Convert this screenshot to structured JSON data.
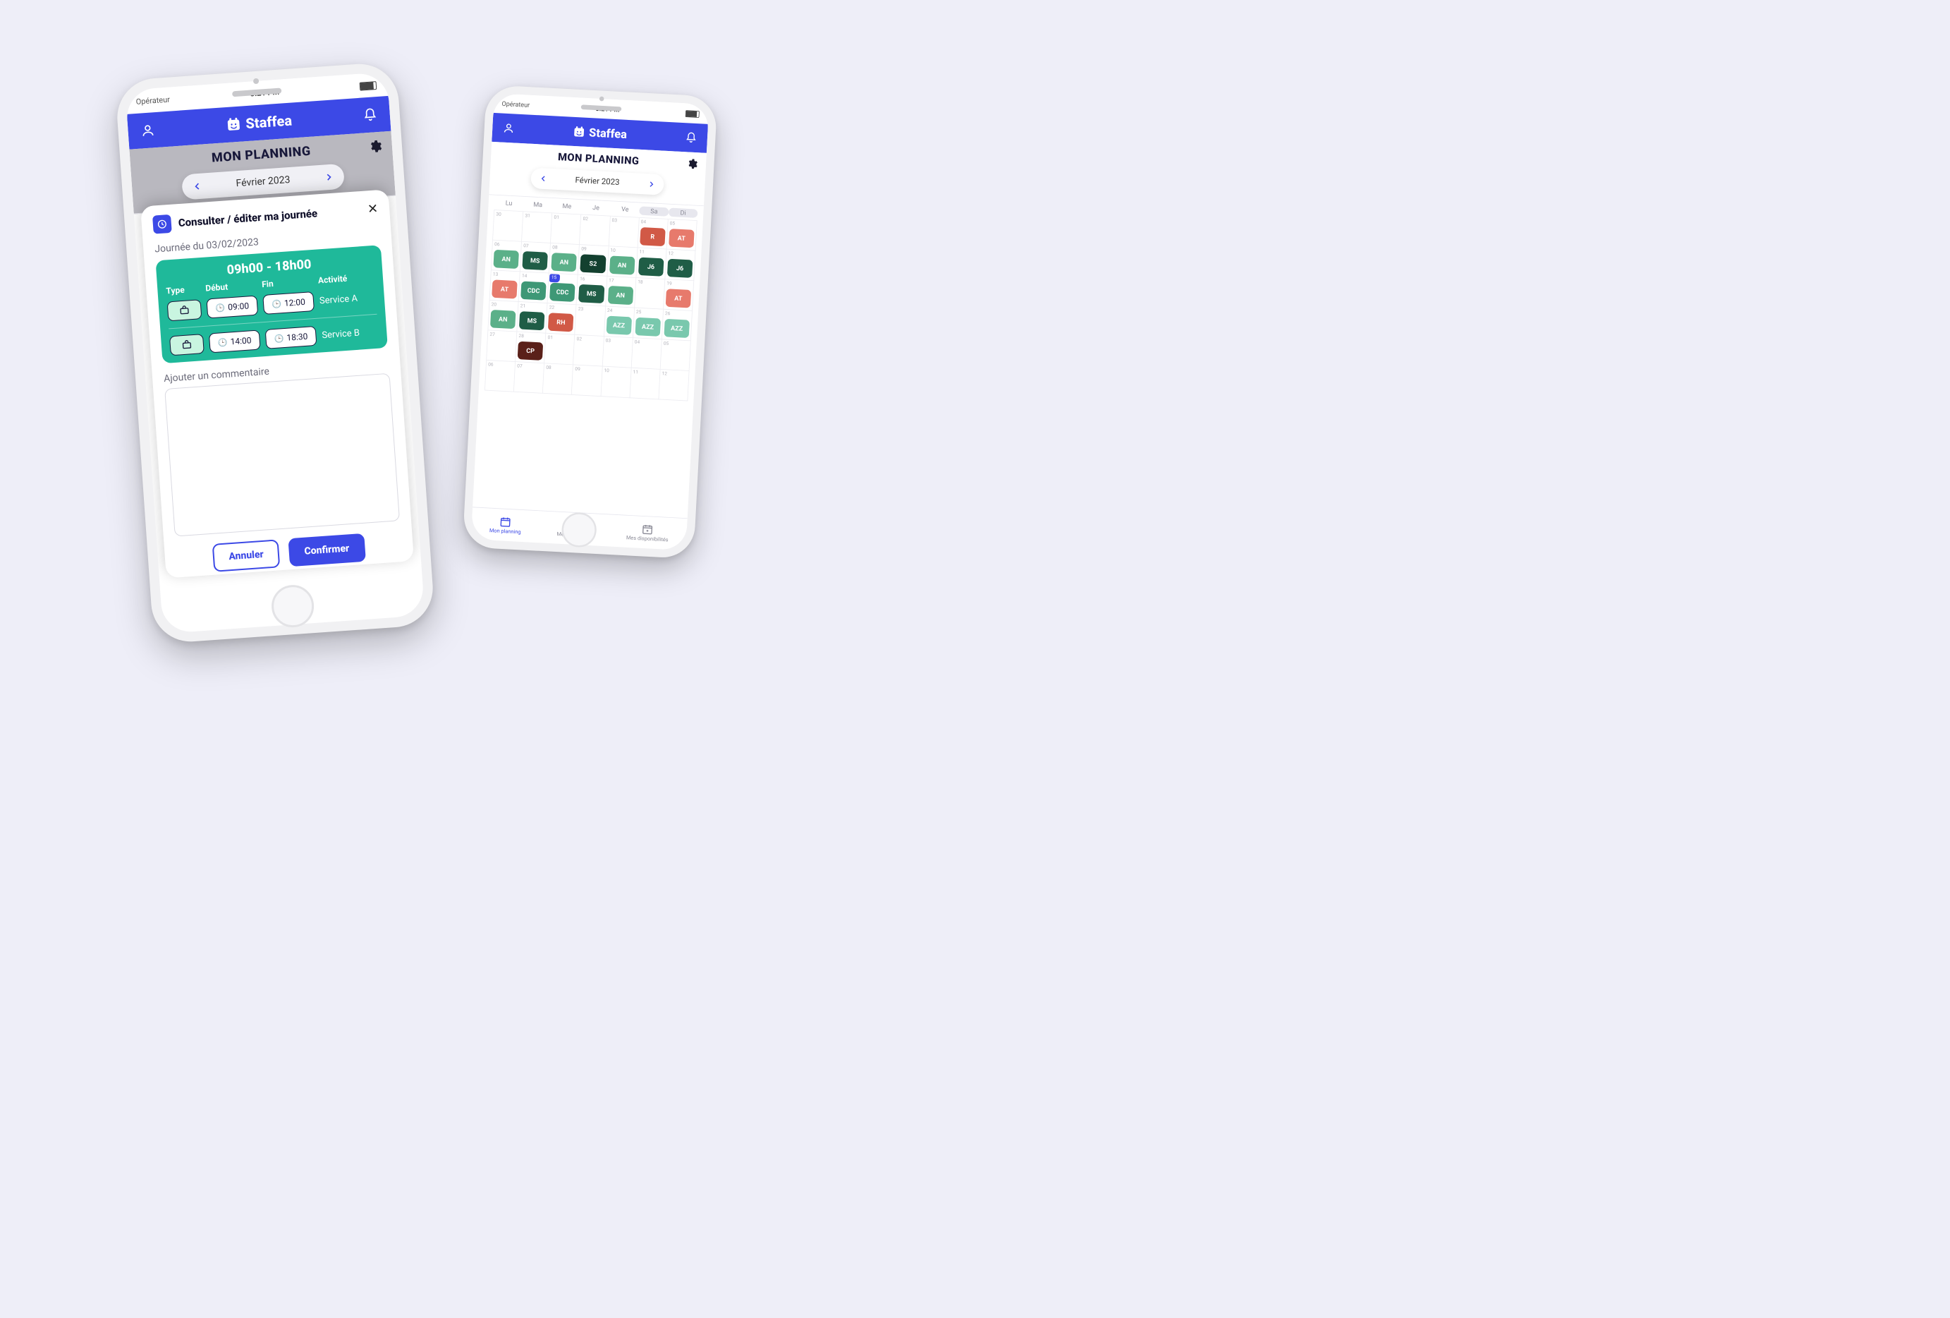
{
  "app": {
    "brand": "Staffea",
    "carrier": "Opérateur",
    "clock": "3:21 PM"
  },
  "left": {
    "title": "MON PLANNING",
    "month": "Février 2023",
    "modal": {
      "heading": "Consulter / éditer ma journée",
      "day_label": "Journée du 03/02/2023",
      "shift_title": "09h00 - 18h00",
      "columns": {
        "type": "Type",
        "start": "Début",
        "end": "Fin",
        "activity": "Activité"
      },
      "rows": [
        {
          "start": "09:00",
          "end": "12:00",
          "activity": "Service A"
        },
        {
          "start": "14:00",
          "end": "18:30",
          "activity": "Service B"
        }
      ],
      "comment_label": "Ajouter un commentaire",
      "cancel": "Annuler",
      "confirm": "Confirmer"
    }
  },
  "right": {
    "title": "MON PLANNING",
    "month": "Février 2023",
    "weekdays": [
      "Lu",
      "Ma",
      "Me",
      "Je",
      "Ve",
      "Sa",
      "Di"
    ],
    "cells": [
      {
        "d": "30"
      },
      {
        "d": "31"
      },
      {
        "d": "01"
      },
      {
        "d": "02"
      },
      {
        "d": "03"
      },
      {
        "d": "04",
        "t": "R",
        "c": "c-orange"
      },
      {
        "d": "05",
        "t": "AT",
        "c": "c-salmon"
      },
      {
        "d": "06",
        "t": "AN",
        "c": "c-lgreen"
      },
      {
        "d": "07",
        "t": "MS",
        "c": "c-dgreen"
      },
      {
        "d": "08",
        "t": "AN",
        "c": "c-lgreen"
      },
      {
        "d": "09",
        "t": "S2",
        "c": "c-deepg"
      },
      {
        "d": "10",
        "t": "AN",
        "c": "c-lgreen"
      },
      {
        "d": "11",
        "t": "J6",
        "c": "c-dgreen"
      },
      {
        "d": "12",
        "t": "J6",
        "c": "c-dgreen"
      },
      {
        "d": "13",
        "t": "AT",
        "c": "c-salmon"
      },
      {
        "d": "14",
        "t": "CDC",
        "c": "c-mgreen"
      },
      {
        "d": "15",
        "t": "CDC",
        "c": "c-mgreen",
        "today": true
      },
      {
        "d": "16",
        "t": "MS",
        "c": "c-dgreen"
      },
      {
        "d": "17",
        "t": "AN",
        "c": "c-lgreen"
      },
      {
        "d": "18"
      },
      {
        "d": "19",
        "t": "AT",
        "c": "c-salmon"
      },
      {
        "d": "20",
        "t": "AN",
        "c": "c-lgreen"
      },
      {
        "d": "21",
        "t": "MS",
        "c": "c-dgreen"
      },
      {
        "d": "22",
        "t": "RH",
        "c": "c-orange"
      },
      {
        "d": "23"
      },
      {
        "d": "24",
        "t": "AZZ",
        "c": "c-teal"
      },
      {
        "d": "25",
        "t": "AZZ",
        "c": "c-teal"
      },
      {
        "d": "26",
        "t": "AZZ",
        "c": "c-teal"
      },
      {
        "d": "27"
      },
      {
        "d": "28",
        "t": "CP",
        "c": "c-brown"
      },
      {
        "d": "01"
      },
      {
        "d": "02"
      },
      {
        "d": "03"
      },
      {
        "d": "04"
      },
      {
        "d": "05"
      },
      {
        "d": "06"
      },
      {
        "d": "07"
      },
      {
        "d": "08"
      },
      {
        "d": "09"
      },
      {
        "d": "10"
      },
      {
        "d": "11"
      },
      {
        "d": "12"
      }
    ],
    "tabs": {
      "planning": "Mon planning",
      "absences": "Mes absences",
      "dispo": "Mes disponibilités"
    }
  }
}
